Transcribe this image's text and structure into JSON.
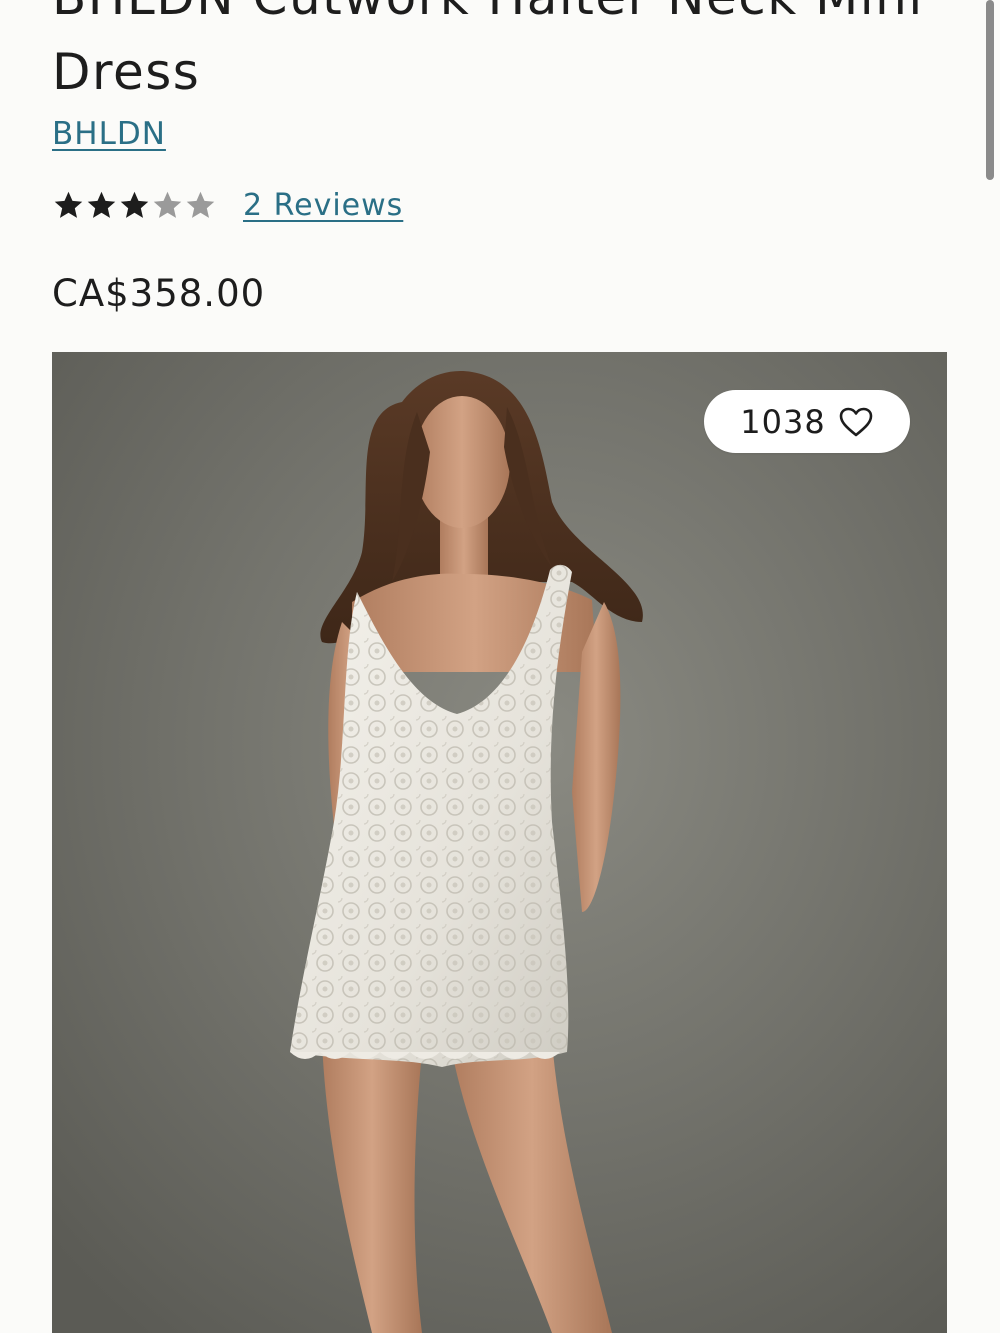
{
  "product": {
    "title": "BHLDN Cutwork Halter Neck Mini Dress",
    "brand": "BHLDN",
    "rating": 3,
    "rating_max": 5,
    "reviews_label": "2 Reviews",
    "price": "CA$358.00"
  },
  "image": {
    "favorites_count": "1038"
  },
  "colors": {
    "link": "#2a6f86",
    "star_filled": "#1d1d1d",
    "star_empty": "#9a9a9a",
    "background": "#fbfbf9"
  },
  "icons": {
    "star": "star-icon",
    "heart": "heart-outline-icon"
  }
}
